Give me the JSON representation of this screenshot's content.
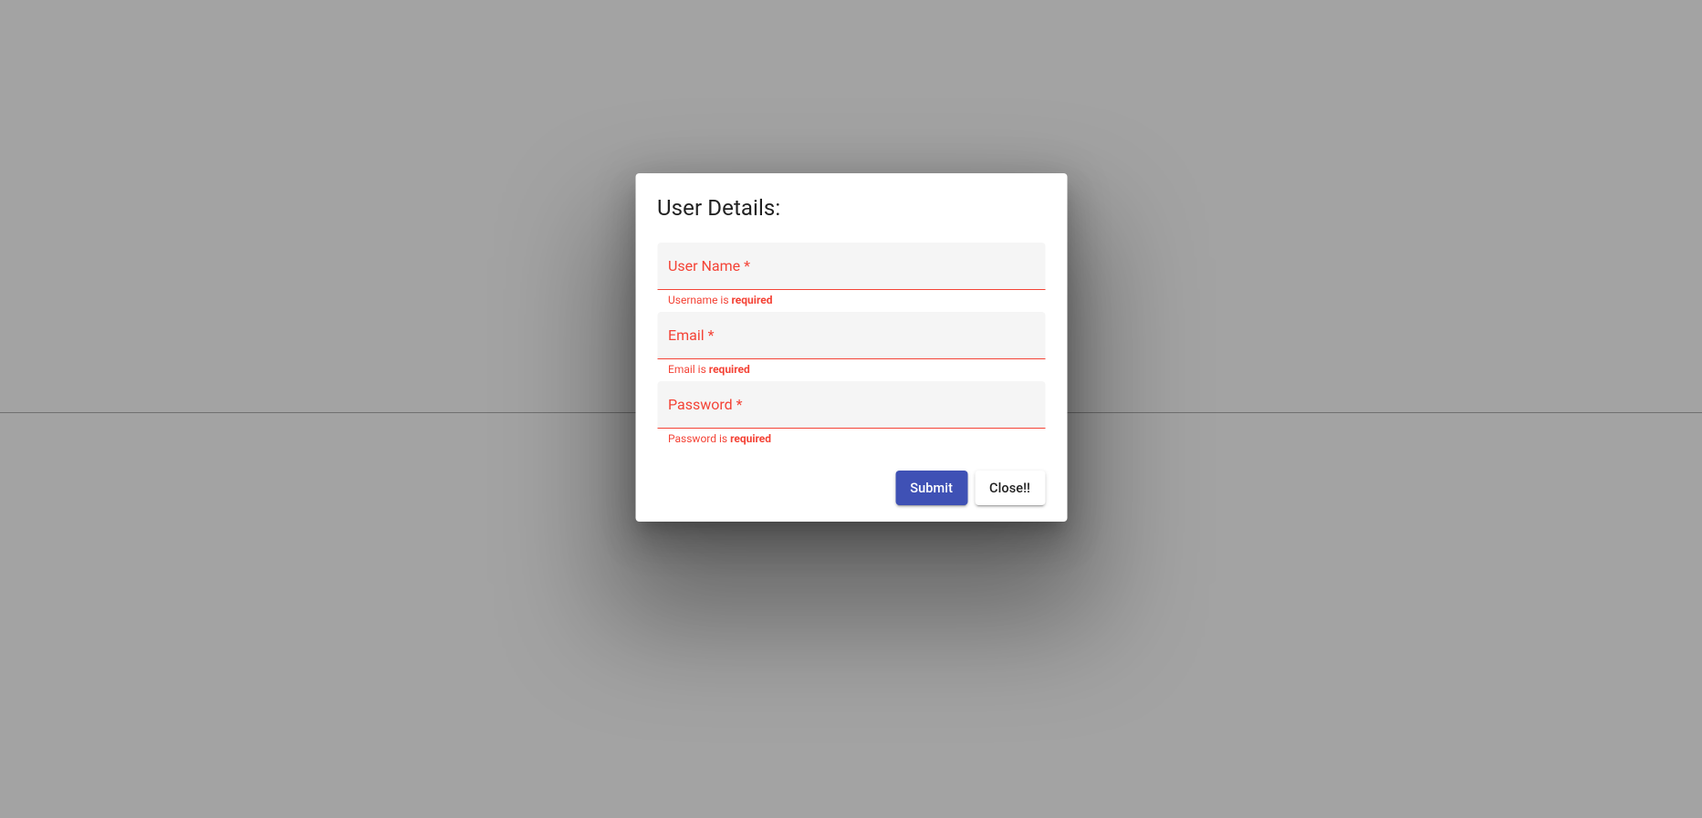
{
  "modal": {
    "title": "User Details:",
    "fields": {
      "username": {
        "label": "User Name *",
        "hint_prefix": "Username is ",
        "hint_strong": "required",
        "value": ""
      },
      "email": {
        "label": "Email *",
        "hint_prefix": "Email is ",
        "hint_strong": "required",
        "value": ""
      },
      "password": {
        "label": "Password *",
        "hint_prefix": "Password is ",
        "hint_strong": "required",
        "value": ""
      }
    },
    "actions": {
      "submit": "Submit",
      "close": "Close!!"
    }
  },
  "colors": {
    "error": "#f44336",
    "primary": "#3f51b5",
    "backdrop": "#a3a3a3"
  }
}
